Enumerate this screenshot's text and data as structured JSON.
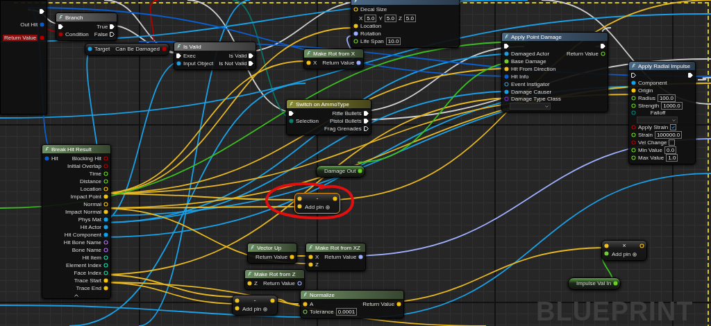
{
  "nodes": [
    {
      "kind": "cut",
      "selected": false,
      "outputs": [
        {
          "kind": "exec",
          "linked": true
        },
        {
          "label": "Out Hit",
          "kind": "struct",
          "linked": true
        },
        {
          "label": "Return Value",
          "kind": "bool",
          "linked": true,
          "highlighted": true
        }
      ]
    },
    {
      "kind": "flow",
      "title": "Branch",
      "selected": false,
      "inputs": [
        {
          "kind": "exec",
          "linked": true
        },
        {
          "label": "Condition",
          "kind": "bool",
          "linked": true
        }
      ],
      "outputs": [
        {
          "label": "True",
          "kind": "exec",
          "linked": true
        },
        {
          "label": "False",
          "kind": "exec",
          "linked": false
        }
      ]
    },
    {
      "kind": "compact",
      "selected": false,
      "inputs": [
        {
          "label": "Target",
          "kind": "object",
          "linked": true
        }
      ],
      "outputs": [
        {
          "label": "Can Be Damaged",
          "kind": "bool",
          "linked": true
        }
      ]
    },
    {
      "kind": "flow",
      "title": "Is Valid",
      "selected": false,
      "inputs": [
        {
          "label": "Exec",
          "kind": "exec",
          "linked": true
        },
        {
          "label": "Input Object",
          "kind": "object",
          "linked": true
        }
      ],
      "outputs": [
        {
          "label": "Is Valid",
          "kind": "exec",
          "linked": true
        },
        {
          "label": "Is Not Valid",
          "kind": "exec",
          "linked": true
        }
      ]
    },
    {
      "kind": "function",
      "selected": false,
      "inputs": [
        {
          "label": "Decal Size",
          "kind": "vector",
          "linked": false,
          "components": [
            {
              "axis": "X",
              "value": "5.0"
            },
            {
              "axis": "Y",
              "value": "5.0"
            },
            {
              "axis": "Z",
              "value": "5.0"
            }
          ]
        },
        {
          "label": "Location",
          "kind": "vector",
          "linked": true
        },
        {
          "label": "Rotation",
          "kind": "rotator",
          "linked": true
        },
        {
          "label": "Life Span",
          "kind": "float",
          "linked": false,
          "value": "10.0"
        }
      ]
    },
    {
      "kind": "pure",
      "title": "Make Rot from X",
      "selected": false,
      "inputs": [
        {
          "label": "X",
          "kind": "vector",
          "linked": true
        }
      ],
      "outputs": [
        {
          "label": "Return Value",
          "kind": "rotator",
          "linked": true
        }
      ]
    },
    {
      "kind": "switch",
      "title": "Switch on AmmoType",
      "selected": false,
      "inputs": [
        {
          "kind": "exec",
          "linked": true
        },
        {
          "label": "Selection",
          "kind": "byte",
          "linked": true
        }
      ],
      "outputs": [
        {
          "label": "Rifle Bullets",
          "kind": "exec",
          "linked": true
        },
        {
          "label": "Pistol Bullets",
          "kind": "exec",
          "linked": true
        },
        {
          "label": "Frag Grenades",
          "kind": "exec",
          "linked": false
        }
      ]
    },
    {
      "kind": "function",
      "title": "Apply Point Damage",
      "selected": false,
      "inputs": [
        {
          "kind": "exec",
          "linked": true
        },
        {
          "label": "Damaged Actor",
          "kind": "object",
          "linked": true
        },
        {
          "label": "Base Damage",
          "kind": "float",
          "linked": true
        },
        {
          "label": "Hit From Direction",
          "kind": "vector",
          "linked": true
        },
        {
          "label": "Hit Info",
          "kind": "struct",
          "linked": true
        },
        {
          "label": "Event Instigator",
          "kind": "object",
          "linked": false
        },
        {
          "label": "Damage Causer",
          "kind": "object",
          "linked": true
        },
        {
          "label": "Damage Type Class",
          "kind": "class",
          "linked": false,
          "dropdown": true
        }
      ],
      "outputs": [
        {
          "kind": "exec",
          "linked": true
        },
        {
          "label": "Return Value",
          "kind": "float",
          "linked": false
        }
      ]
    },
    {
      "kind": "function",
      "title": "Apply Radial Impulse",
      "selected": false,
      "inputs": [
        {
          "kind": "exec",
          "linked": false
        },
        {
          "label": "Component",
          "kind": "object",
          "linked": true
        },
        {
          "label": "Origin",
          "kind": "vector",
          "linked": true
        },
        {
          "label": "Radius",
          "kind": "float",
          "linked": false,
          "value": "100.0"
        },
        {
          "label": "Strength",
          "kind": "float",
          "linked": false,
          "value": "1000.0"
        },
        {
          "label": "Falloff",
          "kind": "byte",
          "linked": false,
          "dropdown": true
        },
        {
          "label": "Apply Strain",
          "kind": "bool",
          "linked": false,
          "checked": true
        },
        {
          "label": "Strain",
          "kind": "float",
          "linked": false,
          "value": "100000.0"
        },
        {
          "label": "Vel Change",
          "kind": "bool",
          "linked": false,
          "checked": false
        },
        {
          "label": "Min Value",
          "kind": "float",
          "linked": false,
          "value": "0.0"
        },
        {
          "label": "Max Value",
          "kind": "float",
          "linked": false,
          "value": "1.0"
        }
      ],
      "outputs": [
        {
          "kind": "exec",
          "linked": true
        }
      ]
    },
    {
      "kind": "variable",
      "selected": false,
      "outputs": [
        {
          "label": "Damage Out",
          "kind": "float",
          "linked": true
        }
      ]
    },
    {
      "kind": "pure",
      "title": "Break Hit Result",
      "selected": false,
      "expander": true,
      "inputs": [
        {
          "label": "Hit",
          "kind": "struct",
          "linked": true
        }
      ],
      "outputs": [
        {
          "label": "Blocking Hit",
          "kind": "bool",
          "linked": false
        },
        {
          "label": "Initial Overlap",
          "kind": "bool",
          "linked": false
        },
        {
          "label": "Time",
          "kind": "float",
          "linked": false
        },
        {
          "label": "Distance",
          "kind": "float",
          "linked": false
        },
        {
          "label": "Location",
          "kind": "vector",
          "linked": false
        },
        {
          "label": "Impact Point",
          "kind": "vector",
          "linked": true
        },
        {
          "label": "Normal",
          "kind": "vector",
          "linked": false
        },
        {
          "label": "Impact Normal",
          "kind": "vector",
          "linked": true
        },
        {
          "label": "Phys Mat",
          "kind": "object",
          "linked": true
        },
        {
          "label": "Hit Actor",
          "kind": "object",
          "linked": true
        },
        {
          "label": "Hit Component",
          "kind": "object",
          "linked": true
        },
        {
          "label": "Hit Bone Name",
          "kind": "name",
          "linked": false
        },
        {
          "label": "Bone Name",
          "kind": "name",
          "linked": false
        },
        {
          "label": "Hit Item",
          "kind": "int",
          "linked": false
        },
        {
          "label": "Element Index",
          "kind": "int",
          "linked": false
        },
        {
          "label": "Face Index",
          "kind": "int",
          "linked": false
        },
        {
          "label": "Trace Start",
          "kind": "vector",
          "linked": true
        },
        {
          "label": "Trace End",
          "kind": "vector",
          "linked": true
        }
      ]
    },
    {
      "kind": "compact",
      "selected": true,
      "operator": "-",
      "add_pin": "Add pin",
      "inputs": [
        {
          "kind": "vector",
          "linked": true
        },
        {
          "kind": "vector",
          "linked": true
        }
      ],
      "outputs": [
        {
          "kind": "vector",
          "linked": true
        }
      ]
    },
    {
      "kind": "pure",
      "title": "Vector Up",
      "selected": false,
      "outputs": [
        {
          "label": "Return Value",
          "kind": "vector",
          "linked": true
        }
      ]
    },
    {
      "kind": "pure",
      "title": "Make Rot from XZ",
      "selected": false,
      "inputs": [
        {
          "label": "X",
          "kind": "vector",
          "linked": true
        },
        {
          "label": "Z",
          "kind": "vector",
          "linked": true
        }
      ],
      "outputs": [
        {
          "label": "Return Value",
          "kind": "rotator",
          "linked": true
        }
      ]
    },
    {
      "kind": "pure",
      "title": "Make Rot from Z",
      "selected": false,
      "inputs": [
        {
          "label": "Z",
          "kind": "vector",
          "linked": true
        }
      ],
      "outputs": [
        {
          "label": "Return Value",
          "kind": "rotator",
          "linked": false
        }
      ]
    },
    {
      "kind": "compact",
      "selected": false,
      "operator": "-",
      "add_pin": "Add pin",
      "inputs": [
        {
          "kind": "vector",
          "linked": true
        },
        {
          "kind": "vector",
          "linked": true
        }
      ],
      "outputs": [
        {
          "kind": "vector",
          "linked": true
        }
      ]
    },
    {
      "kind": "pure",
      "title": "Normalize",
      "selected": false,
      "inputs": [
        {
          "label": "A",
          "kind": "vector",
          "linked": true
        },
        {
          "label": "Tolerance",
          "kind": "float",
          "linked": false,
          "value": "0.0001"
        }
      ],
      "outputs": [
        {
          "label": "Return Value",
          "kind": "vector",
          "linked": true
        }
      ]
    },
    {
      "kind": "compact",
      "selected": false,
      "operator": "×",
      "add_pin": "Add pin",
      "inputs": [
        {
          "kind": "vector",
          "linked": true
        },
        {
          "kind": "float",
          "linked": true
        }
      ],
      "outputs": [
        {
          "kind": "vector",
          "linked": false
        }
      ]
    },
    {
      "kind": "variable",
      "selected": false,
      "outputs": [
        {
          "label": "Impulse Val In",
          "kind": "float",
          "linked": true
        }
      ]
    }
  ],
  "watermark": "BLUEPRINT"
}
